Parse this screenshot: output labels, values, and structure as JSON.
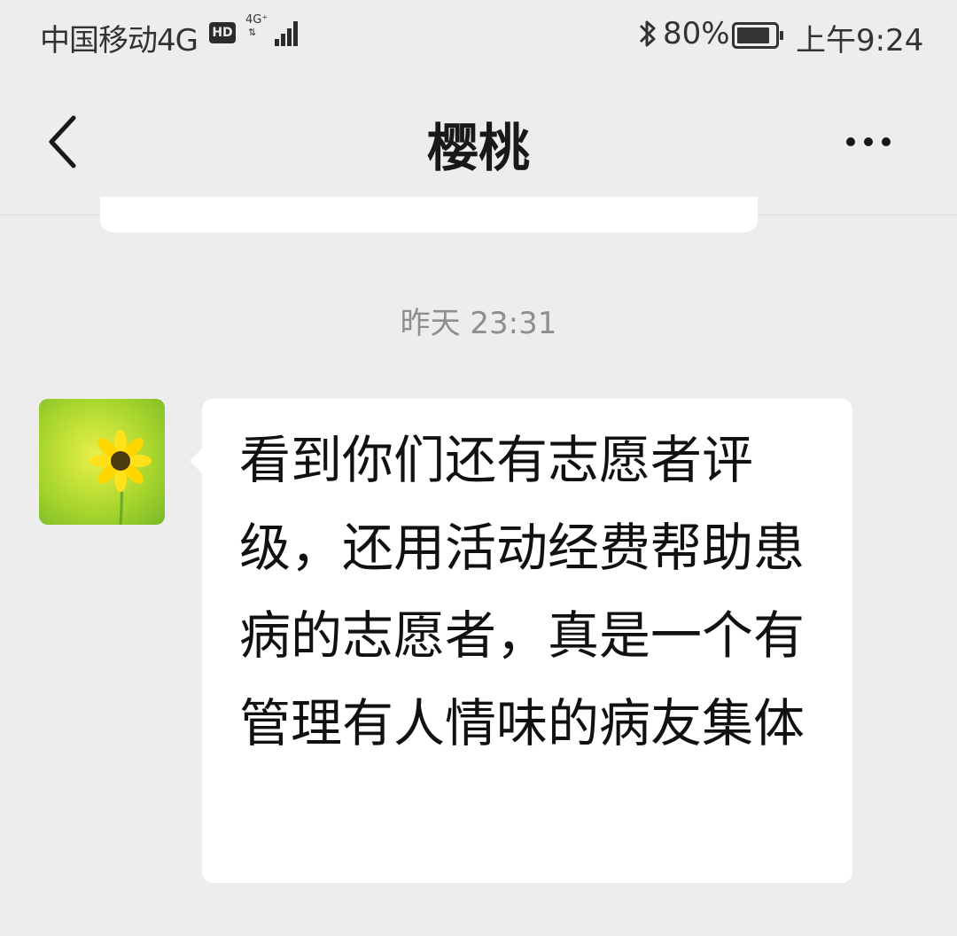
{
  "status_bar": {
    "carrier": "中国移动4G",
    "hd_badge": "HD",
    "network": "4G⁺",
    "network_sub": "⇅",
    "battery": "80%",
    "time": "上午9:24",
    "icons": [
      "signal-icon",
      "bluetooth-icon",
      "battery-icon"
    ]
  },
  "nav": {
    "title": "樱桃",
    "back_icon": "chevron-left-icon",
    "more_icon": "more-dots-icon"
  },
  "conversation": {
    "timestamp": "昨天 23:31",
    "messages": [
      {
        "sender": "incoming",
        "avatar_icon": "sunflower-avatar",
        "text": "看到你们还有志愿者评级，还用活动经费帮助患病的志愿者，真是一个有管理有人情味的病友集体"
      }
    ]
  },
  "colors": {
    "background": "#ededed",
    "bubble": "#ffffff",
    "timestamp_text": "#8e8e8e",
    "title_text": "#191919"
  }
}
